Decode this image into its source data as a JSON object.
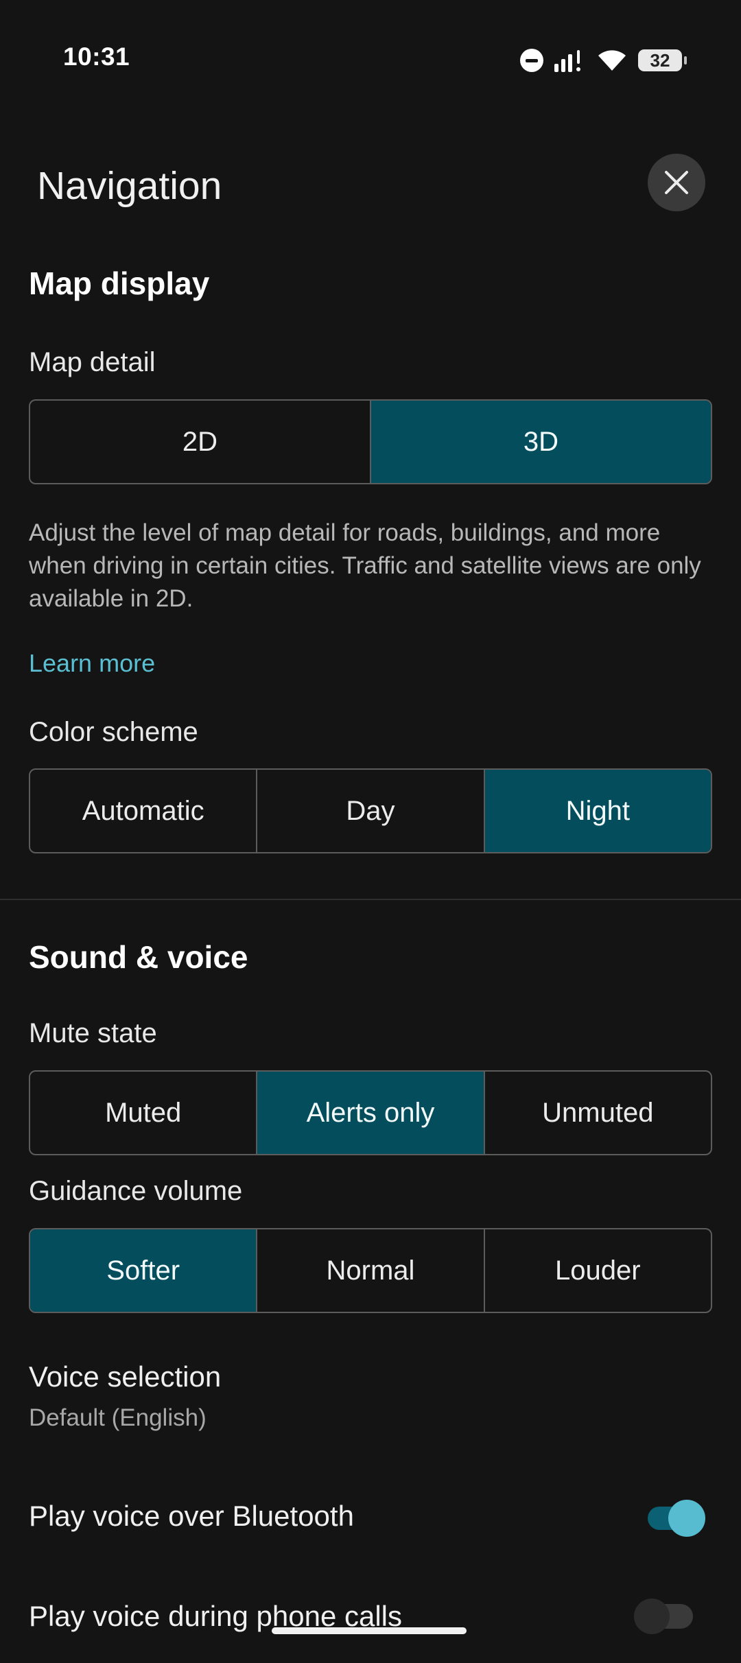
{
  "status_bar": {
    "time": "10:31",
    "battery": "32",
    "icons": [
      "do-not-disturb-icon",
      "signal-icon",
      "wifi-icon",
      "battery-icon"
    ]
  },
  "header": {
    "title": "Navigation",
    "close_icon": "close-icon"
  },
  "map_display": {
    "title": "Map display",
    "map_detail": {
      "label": "Map detail",
      "options": [
        "2D",
        "3D"
      ],
      "selected": "3D"
    },
    "description": "Adjust the level of map detail for roads, buildings, and more when driving in certain cities. Traffic and satellite views are only available in 2D.",
    "learn_more": "Learn more",
    "color_scheme": {
      "label": "Color scheme",
      "options": [
        "Automatic",
        "Day",
        "Night"
      ],
      "selected": "Night"
    }
  },
  "sound_voice": {
    "title": "Sound & voice",
    "mute_state": {
      "label": "Mute state",
      "options": [
        "Muted",
        "Alerts only",
        "Unmuted"
      ],
      "selected": "Alerts only"
    },
    "guidance_volume": {
      "label": "Guidance volume",
      "options": [
        "Softer",
        "Normal",
        "Louder"
      ],
      "selected": "Softer"
    },
    "voice_selection": {
      "title": "Voice selection",
      "value": "Default (English)"
    },
    "bluetooth": {
      "label": "Play voice over Bluetooth",
      "enabled": true
    },
    "phone_calls": {
      "label": "Play voice during phone calls",
      "enabled": false
    }
  },
  "colors": {
    "background": "#141414",
    "selected_segment": "#044d5c",
    "link": "#5bbfd3",
    "toggle_on": "#57bcd0"
  }
}
